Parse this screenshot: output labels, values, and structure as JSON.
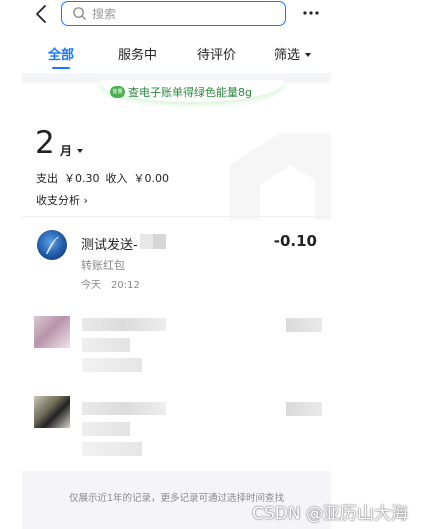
{
  "header": {
    "search_placeholder": "搜索",
    "back_icon": "chevron-left-icon",
    "more_icon": "more-dots-icon"
  },
  "tabs": [
    {
      "label": "全部",
      "active": true
    },
    {
      "label": "服务中",
      "active": false
    },
    {
      "label": "待评价",
      "active": false
    },
    {
      "label": "筛选",
      "active": false
    }
  ],
  "banner": {
    "badge": "能量",
    "text": "查电子账单得绿色能量8g"
  },
  "summary": {
    "month": "2",
    "month_unit": "月",
    "expense_label": "支出",
    "expense_value": "￥0.30",
    "income_label": "收入",
    "income_value": "￥0.00",
    "analysis_label": "收支分析",
    "analysis_arrow": "›"
  },
  "transaction": {
    "title": "测试发送-",
    "amount": "-0.10",
    "subtitle": "转账红包",
    "day": "今天",
    "time": "20:12"
  },
  "footer": {
    "note": "仅展示近1年的记录，更多记录可通过选择时间查找"
  },
  "watermark": "CSDN @亚历山大海",
  "colors": {
    "accent": "#1677ff",
    "banner_green": "#2b8a3e"
  }
}
